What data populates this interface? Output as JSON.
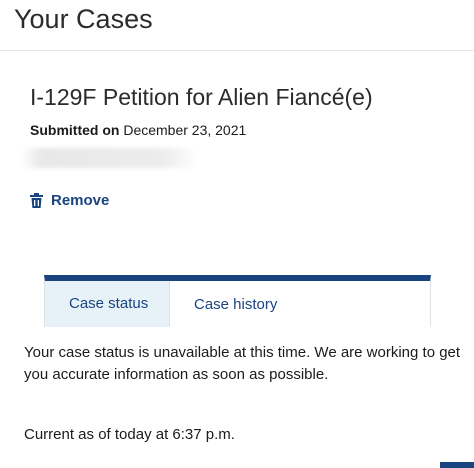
{
  "header": {
    "title": "Your Cases"
  },
  "case": {
    "title": "I-129F Petition for Alien Fiancé(e)",
    "submitted_label": "Submitted on",
    "submitted_date": "December 23, 2021",
    "remove_label": "Remove"
  },
  "tabs": [
    {
      "label": "Case status",
      "active": true
    },
    {
      "label": "Case history",
      "active": false
    }
  ],
  "status": {
    "message": "Your case status is unavailable at this time. We are working to get you accurate information as soon as possible.",
    "current_as_of": "Current as of of today at 6:37 p.m."
  },
  "colors": {
    "accent": "#1a4480",
    "active_tab_bg": "#e7f2f8"
  },
  "icons": {
    "remove": "trash-icon"
  }
}
